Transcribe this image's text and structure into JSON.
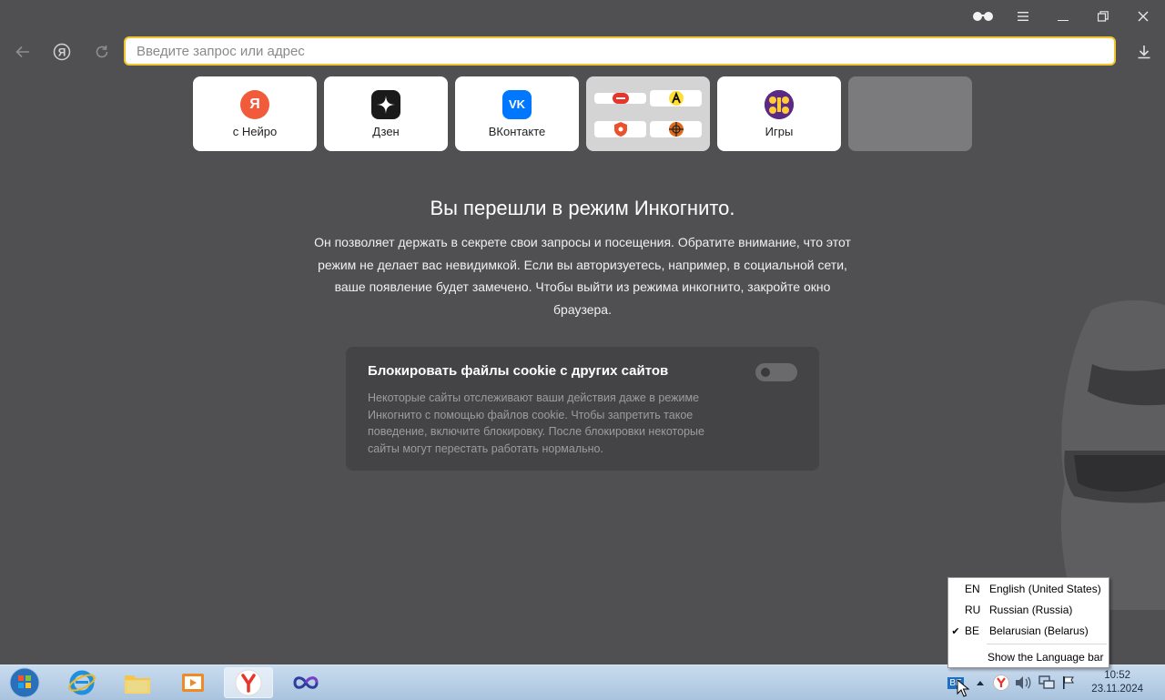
{
  "browser": {
    "address_bar": {
      "placeholder": "Введите запрос или адрес"
    },
    "tiles": [
      {
        "label": "с Нейро",
        "icon": "yandex-neuro-icon",
        "icon_text": "Я",
        "color": "#f15a3a"
      },
      {
        "label": "Дзен",
        "icon": "dzen-icon",
        "color": "#1a1a1a"
      },
      {
        "label": "ВКонтакте",
        "icon": "vk-icon",
        "icon_text": "VK",
        "color": "#0077ff"
      },
      {
        "label": "",
        "icon": "multi-sites-icon"
      },
      {
        "label": "Игры",
        "icon": "games-icon",
        "color": "#5b2a86"
      },
      {
        "label": "",
        "icon": "empty-tile"
      }
    ]
  },
  "incognito": {
    "title": "Вы перешли в режим Инкогнито.",
    "text": "Он позволяет держать в секрете свои запросы и посещения. Обратите внимание, что этот режим не делает вас невидимкой. Если вы авторизуетесь, например, в социальной сети, ваше появление будет замечено. Чтобы выйти из режима инкогнито, закройте окно браузера."
  },
  "cookie_card": {
    "title": "Блокировать файлы cookie с других сайтов",
    "description": "Некоторые сайты отслеживают ваши действия даже в режиме Инкогнито с помощью файлов cookie. Чтобы запретить такое поведение, включите блокировку. После блокировки некоторые сайты могут перестать работать нормально.",
    "toggle_on": false
  },
  "language_menu": {
    "items": [
      {
        "code": "EN",
        "name": "English (United States)",
        "checked": false
      },
      {
        "code": "RU",
        "name": "Russian (Russia)",
        "checked": false
      },
      {
        "code": "BE",
        "name": "Belarusian (Belarus)",
        "checked": true
      }
    ],
    "show_bar": "Show the Language bar",
    "check_mark": "✔"
  },
  "taskbar": {
    "lang_indicator": "BE",
    "time": "10:52",
    "date": "23.11.2024"
  },
  "colors": {
    "accent": "#f3c32b",
    "background": "#505053"
  }
}
